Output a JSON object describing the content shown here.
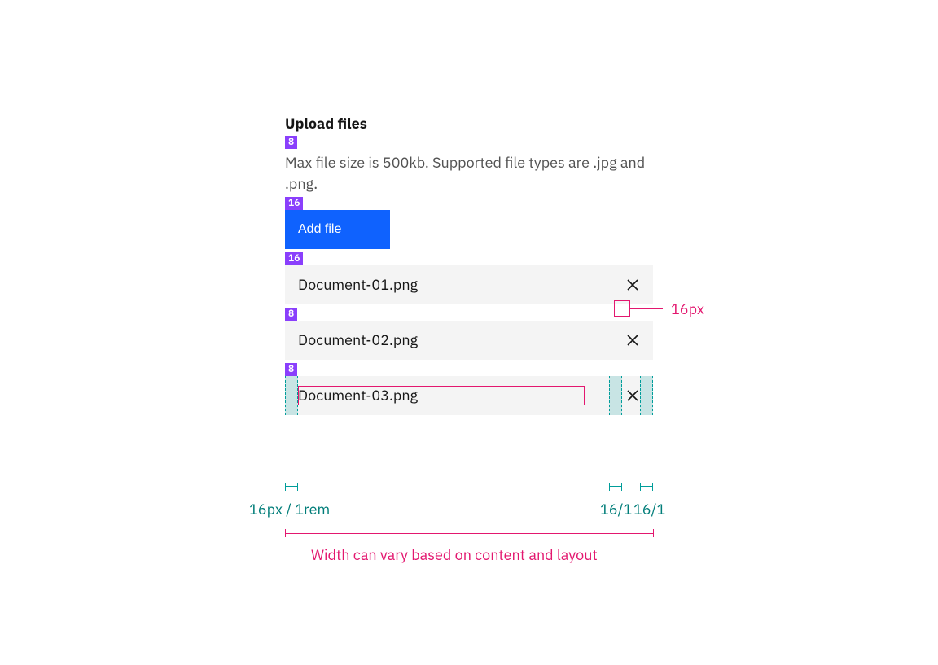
{
  "heading": "Upload files",
  "helper": "Max file size is 500kb. Supported file types are .jpg and .png.",
  "button_label": "Add file",
  "spacers": {
    "heading_helper": "8",
    "helper_button": "16",
    "button_list": "16",
    "row1_row2": "8",
    "row2_row3": "8"
  },
  "files": [
    {
      "name": "Document-01.png"
    },
    {
      "name": "Document-02.png"
    },
    {
      "name": "Document-03.png"
    }
  ],
  "annotations": {
    "close_icon_size": "16px",
    "left_padding": "16px / 1rem",
    "mid_padding": "16/1",
    "right_padding": "16/1",
    "width_note": "Width can vary based on content and layout"
  }
}
